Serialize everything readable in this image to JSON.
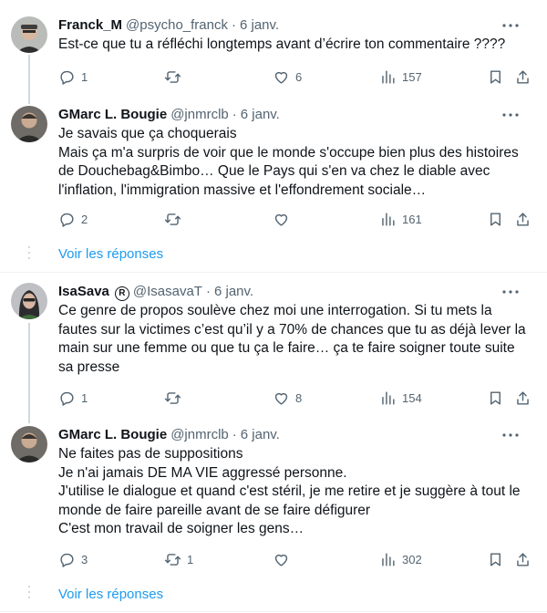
{
  "tweets": [
    {
      "name": "Franck_M",
      "handle": "@psycho_franck",
      "date": "6 janv.",
      "text": "Est-ce que tu a réfléchi longtemps avant d’écrire ton commentaire ????",
      "replies": "1",
      "retweets": "",
      "likes": "6",
      "views": "157"
    },
    {
      "name": "GMarc L. Bougie",
      "handle": "@jnmrclb",
      "date": "6 janv.",
      "text": "Je savais que ça choquerais\nMais ça m'a surpris de voir que le monde s'occupe bien plus des histoires de Douchebag&Bimbo… Que le Pays qui s'en va chez le diable avec l'inflation, l'immigration massive et l'effondrement sociale…",
      "replies": "2",
      "retweets": "",
      "likes": "",
      "views": "161"
    },
    {
      "name": "IsaSava",
      "handle": "@IsasavaT",
      "date": "6 janv.",
      "badge": "R",
      "text": "Ce genre de propos soulève chez moi une interrogation. Si tu mets la fautes sur la victimes c’est qu’il y a 70% de chances que tu as déjà lever la main sur une femme ou que tu ça le faire… ça te faire soigner toute suite sa presse",
      "replies": "1",
      "retweets": "",
      "likes": "8",
      "views": "154"
    },
    {
      "name": "GMarc L. Bougie",
      "handle": "@jnmrclb",
      "date": "6 janv.",
      "text": "Ne faites pas de suppositions\nJe n'ai jamais DE MA VIE aggressé personne.\nJ'utilise le dialogue et quand c'est stéril, je me retire et je suggère à tout le monde de faire pareille avant de se faire défigurer\nC'est mon travail de soigner les gens…",
      "replies": "3",
      "retweets": "1",
      "likes": "",
      "views": "302"
    }
  ],
  "show_replies_label": "Voir les réponses",
  "icons": [
    "more-icon",
    "reply-icon",
    "retweet-icon",
    "like-icon",
    "views-icon",
    "bookmark-icon",
    "share-icon",
    "registered-icon"
  ],
  "colors": {
    "link": "#1d9bf0",
    "muted": "#536471",
    "text": "#0f1419",
    "thread_line": "#cfd9de"
  }
}
